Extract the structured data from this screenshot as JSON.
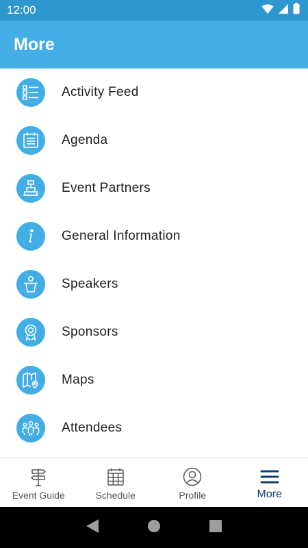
{
  "status_bar": {
    "time": "12:00"
  },
  "app_bar": {
    "title": "More"
  },
  "menu": [
    {
      "label": "Activity Feed",
      "icon": "list-icon"
    },
    {
      "label": "Agenda",
      "icon": "agenda-icon"
    },
    {
      "label": "Event Partners",
      "icon": "podium-icon"
    },
    {
      "label": "General Information",
      "icon": "info-icon"
    },
    {
      "label": "Speakers",
      "icon": "speaker-icon"
    },
    {
      "label": "Sponsors",
      "icon": "ribbon-award-icon"
    },
    {
      "label": "Maps",
      "icon": "map-icon"
    },
    {
      "label": "Attendees",
      "icon": "attendees-icon"
    }
  ],
  "bottom_nav": [
    {
      "label": "Event Guide",
      "icon": "signpost-icon",
      "active": false
    },
    {
      "label": "Schedule",
      "icon": "calendar-icon",
      "active": false
    },
    {
      "label": "Profile",
      "icon": "profile-icon",
      "active": false
    },
    {
      "label": "More",
      "icon": "hamburger-menu-icon",
      "active": true
    }
  ],
  "colors": {
    "status_bar": "#2f97cf",
    "app_bar": "#43aee6",
    "icon_circle": "#43aee6",
    "active_nav": "#0e3c6e"
  }
}
